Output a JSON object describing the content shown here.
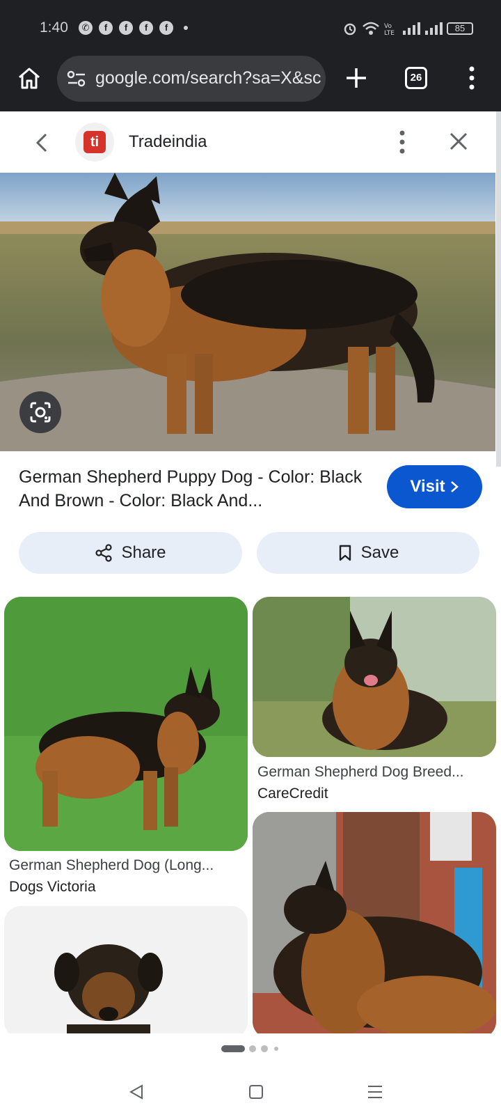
{
  "status_bar": {
    "time": "1:40",
    "notifications": [
      "whatsapp-icon",
      "facebook-icon",
      "facebook-icon",
      "facebook-icon",
      "facebook-icon"
    ],
    "battery": "85"
  },
  "browser": {
    "url": "google.com/search?sa=X&sca",
    "tab_count": "26"
  },
  "panel": {
    "site_name": "Tradeindia",
    "logo_text": "ti",
    "title": "German Shepherd Puppy Dog - Color: Black And Brown - Color: Black And...",
    "visit_label": "Visit",
    "share_label": "Share",
    "save_label": "Save"
  },
  "related": [
    {
      "caption": "German Shepherd Dog (Long...",
      "source": "Dogs Victoria"
    },
    {
      "caption": "German Shepherd Dog Breed...",
      "source": "CareCredit"
    }
  ],
  "colors": {
    "accent": "#0b57d0",
    "pill_bg": "#e8eef8",
    "dark_bar": "#1f2023"
  }
}
